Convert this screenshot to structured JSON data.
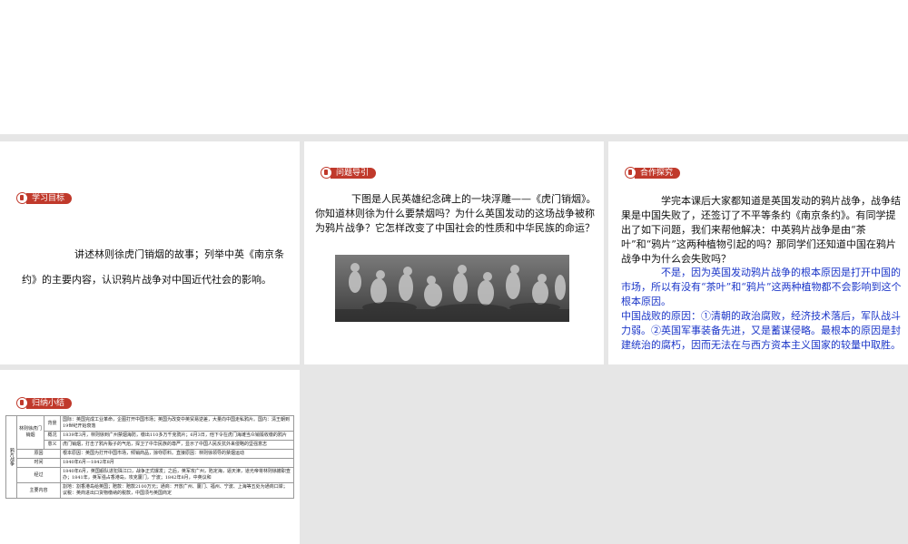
{
  "cards": {
    "objectives": {
      "tag": "学习目标",
      "line1": "讲述林则徐虎门销烟的故事；列举中英《南京条",
      "line2": "约》的主要内容，认识鸦片战争对中国近代社会的影响。"
    },
    "guide": {
      "tag": "问题导引",
      "text": "下图是人民英雄纪念碑上的一块浮雕——《虎门销烟》。你知道林则徐为什么要禁烟吗？为什么英国发动的这场战争被称为鸦片战争？它怎样改变了中国社会的性质和中华民族的命运？"
    },
    "inquiry": {
      "tag": "合作探究",
      "text": "学完本课后大家都知道是英国发动的鸦片战争，战争结果是中国失败了，还签订了不平等条约《南京条约》。有同学提出了如下问题，我们来帮他解决：中英鸦片战争是由“茶叶”和“鸦片”这两种植物引起的吗？那同学们还知道中国在鸦片战争中为什么会失败吗？",
      "answer1": "不是，因为英国发动鸦片战争的根本原因是打开中国的市场，所以有没有“茶叶”和“鸦片”这两种植物都不会影响到这个根本原因。",
      "answer2": "中国战败的原因：①清朝的政治腐败，经济技术落后，军队战斗力弱。②英国军事装备先进，又是蓄谋侵略。最根本的原因是封建统治的腐朽，因而无法在与西方资本主义国家的较量中取胜。"
    },
    "summary": {
      "tag": "归纳小结",
      "root": "鸦片战争",
      "group": "林则徐虎门销烟",
      "rows": [
        {
          "label": "背景",
          "content": "国际：英国完成工业革命，企图打开中国市场；英国为改变中英贸易逆差，大量向中国走私鸦片。国内：清王朝到19世纪开始衰落"
        },
        {
          "label": "概况",
          "content": "1839年3月，林则徐到广州禁烟海防，缴出110多万千克鸦片；6月3日，他下令在虎门海滩当众销毁收缴的鸦片"
        },
        {
          "label": "意义",
          "content": "虎门销烟，打击了鸦片贩子的气焰，捍卫了中华民族的尊严，显示了中国人民反抗外来侵略的坚强意志"
        },
        {
          "label": "原因",
          "content": "根本原因：英国为打开中国市场，倾销商品，掠夺原料。直接原因：林则徐领导的禁烟运动"
        },
        {
          "label": "时间",
          "content": "1840年6月—1842年8月"
        },
        {
          "label": "经过",
          "content": "1840年6月，英国舰队进犯珠江口，战争正式爆发；之后，英军攻广州，陷定海，逼天津，道光帝将林则徐撤职查办；1841年，英军强占香港岛，攻克厦门，宁波；1842年8月，中英议和"
        },
        {
          "label": "主要内容",
          "content": "割地：割香港岛给英国；赔款：赔款2100万元；通商：开放广州、厦门、福州、宁波、上海等五处为通商口岸；议税：英商进出口货物缴纳的税款，中国须与英国商定"
        }
      ]
    }
  }
}
